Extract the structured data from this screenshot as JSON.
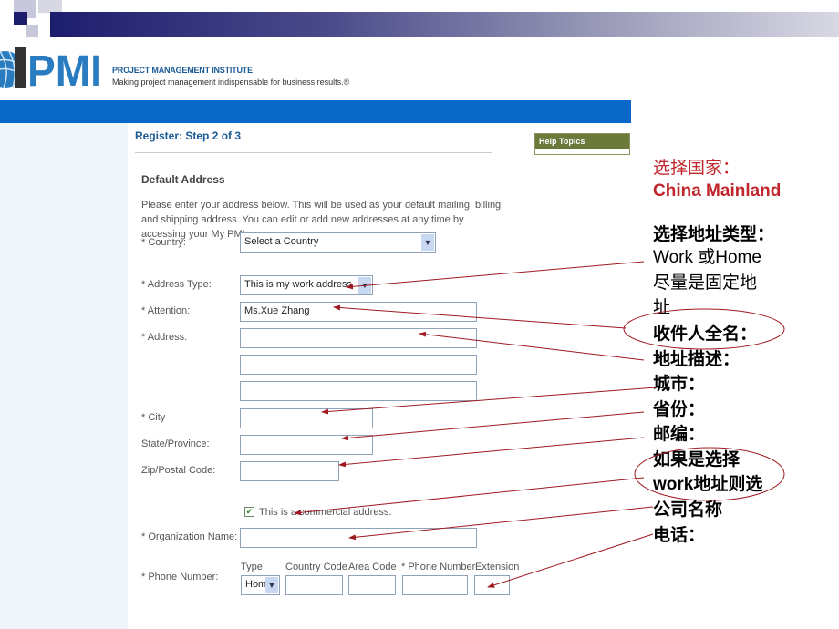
{
  "header": {
    "org_name": "PROJECT MANAGEMENT INSTITUTE",
    "tagline": "Making project management indispensable for business results.®",
    "logo_text": "PMI"
  },
  "page": {
    "title": "Register: Step 2 of 3",
    "help_label": "Help Topics",
    "section_title": "Default Address",
    "description": "Please enter your address below. This will be used as your default mailing, billing and shipping address. You can edit or add new addresses at any time by accessing your My PMI page."
  },
  "form": {
    "country": {
      "label": "* Country:",
      "value": "Select a Country"
    },
    "address_type": {
      "label": "* Address Type:",
      "value": "This is my work address"
    },
    "attention": {
      "label": "* Attention:",
      "value": "Ms.Xue Zhang"
    },
    "address": {
      "label": "* Address:",
      "lines": [
        "",
        "",
        ""
      ]
    },
    "city": {
      "label": "* City",
      "value": ""
    },
    "state": {
      "label": "State/Province:",
      "value": ""
    },
    "zip": {
      "label": "Zip/Postal Code:",
      "value": ""
    },
    "commercial": {
      "label": "This is a commercial address.",
      "checked": true
    },
    "organization": {
      "label": "* Organization Name:",
      "value": ""
    },
    "phone": {
      "label": "* Phone Number:",
      "col_type": "Type",
      "col_country": "Country Code",
      "col_area": "Area Code",
      "col_number": "* Phone Number",
      "col_ext": "Extension",
      "type_value": "Home"
    }
  },
  "annotations": {
    "country_line1": "选择国家：",
    "country_line2": "China Mainland",
    "type_line1": "选择地址类型：",
    "type_line2": "Work 或Home",
    "type_line3": "尽量是固定地",
    "type_line4": "址",
    "attention": "收件人全名：",
    "address": "地址描述：",
    "city": "城市：",
    "state": "省份：",
    "zip": "邮编：",
    "org_line1": "如果是选择",
    "org_line2": "work地址则选",
    "org_line3": "公司名称",
    "phone": "电话：",
    "arrow_color": "#a01820",
    "highlight_color": "#c0262b"
  }
}
